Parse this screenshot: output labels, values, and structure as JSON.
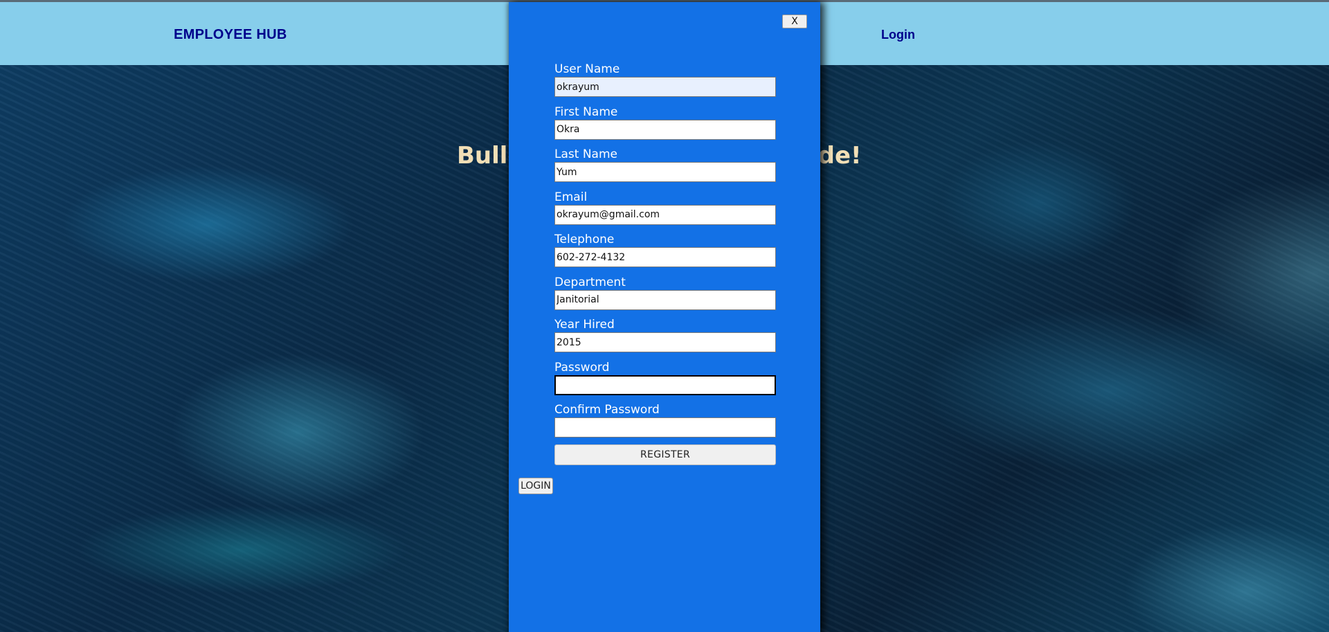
{
  "navbar": {
    "brand": "EMPLOYEE HUB",
    "login_link": "Login"
  },
  "hero": {
    "headline_left": "Bulle",
    "headline_right": "ide!"
  },
  "modal": {
    "close_label": "X",
    "fields": [
      {
        "label": "User Name",
        "value": "okrayum"
      },
      {
        "label": "First Name",
        "value": "Okra"
      },
      {
        "label": "Last Name",
        "value": "Yum"
      },
      {
        "label": "Email",
        "value": "okrayum@gmail.com"
      },
      {
        "label": "Telephone",
        "value": "602-272-4132"
      },
      {
        "label": "Department",
        "value": "Janitorial"
      },
      {
        "label": "Year Hired",
        "value": "2015"
      },
      {
        "label": "Password",
        "value": ""
      },
      {
        "label": "Confirm Password",
        "value": ""
      }
    ],
    "register_label": "REGISTER",
    "login_label": "LOGIN"
  },
  "colors": {
    "navbar_bg": "#87ceeb",
    "brand_text": "#00008b",
    "modal_bg": "#1371e6",
    "headline_text": "#f2dfb6"
  }
}
